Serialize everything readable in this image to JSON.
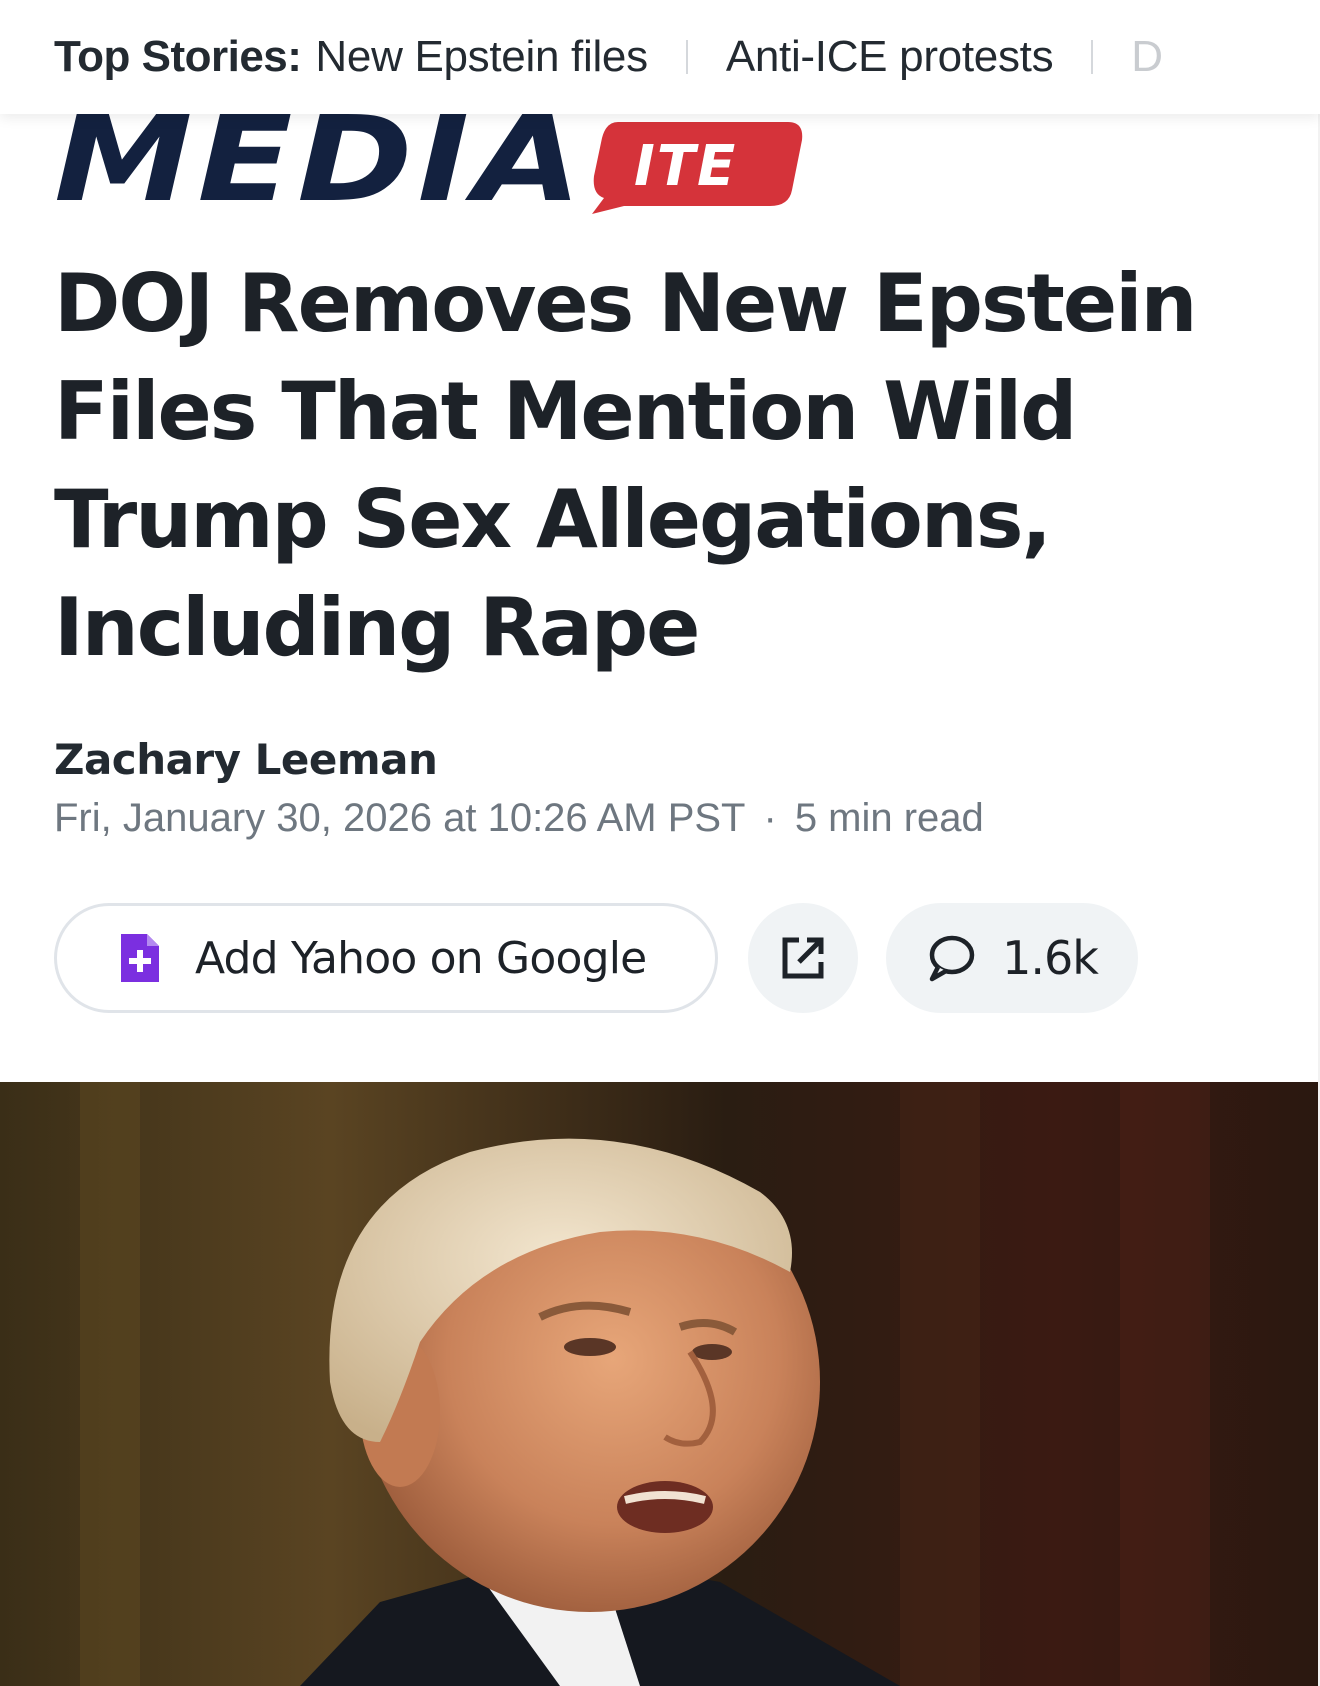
{
  "top_stories": {
    "label": "Top Stories:",
    "items": [
      "New Epstein files",
      "Anti-ICE protests",
      "D"
    ]
  },
  "publisher": {
    "logo_text": "MEDIA",
    "logo_badge": "ITE",
    "colors": {
      "navy": "#13213f",
      "red": "#d5333a"
    }
  },
  "article": {
    "headline": "DOJ Removes New Epstein Files That Mention Wild Trump Sex Allegations, Including Rape",
    "author": "Zachary Leeman",
    "published": "Fri, January 30, 2026 at 10:26 AM PST",
    "separator": "·",
    "read_time": "5 min read"
  },
  "actions": {
    "add_google_label": "Add Yahoo on Google",
    "add_google_icon": "document-plus-icon",
    "share_icon": "external-link-icon",
    "comments_icon": "speech-bubble-icon",
    "comments_count": "1.6k",
    "accent_color": "#7b2fe0"
  }
}
